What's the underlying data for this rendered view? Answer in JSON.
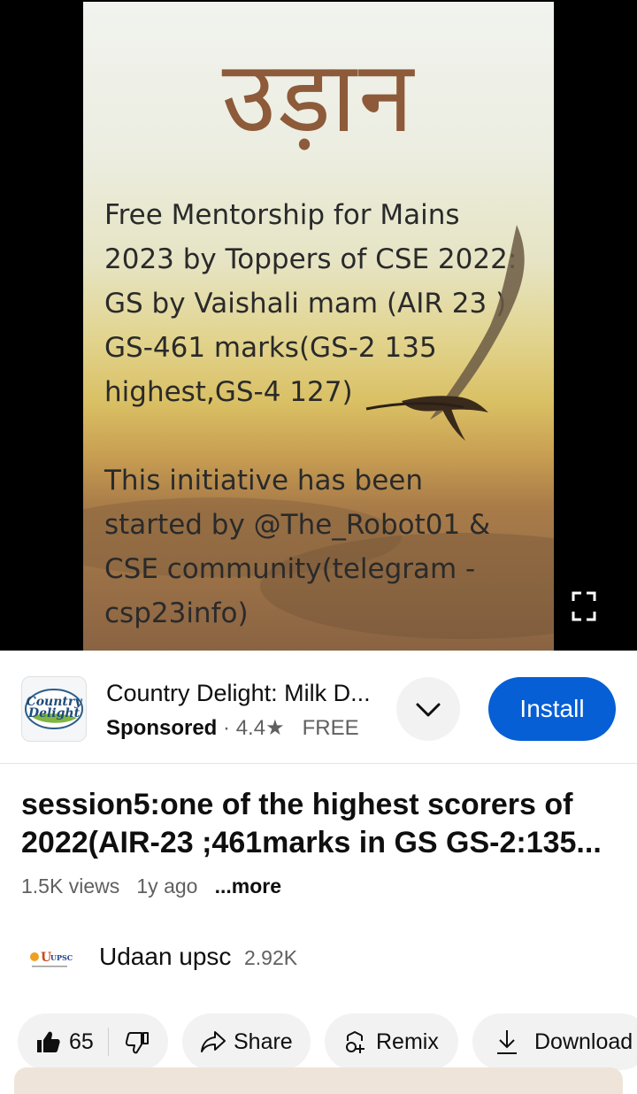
{
  "video": {
    "poster_title": "उड़ान",
    "poster_lines": [
      "Free Mentorship for Mains",
      "2023 by Toppers of CSE 2022:",
      "GS by Vaishali mam (AIR 23 )",
      "GS-461 marks(GS-2 135",
      "highest,GS-4 127)",
      "This initiative has been",
      "started by @The_Robot01 &",
      "CSE community(telegram -",
      "csp23info)"
    ],
    "progress_fraction": 0.03
  },
  "ad": {
    "logo_text_1": "Country",
    "logo_text_2": "Delight",
    "title": "Country Delight: Milk D...",
    "sponsored": "Sponsored",
    "separator": "·",
    "rating": "4.4",
    "price": "FREE",
    "install_label": "Install",
    "colors": {
      "install_bg": "#065fd4"
    }
  },
  "video_title": {
    "line1": "session5:one of the highest scorers of",
    "line2": "2022(AIR-23 ;461marks in GS GS-2:135..."
  },
  "meta": {
    "views": "1.5K views",
    "age": "1y ago",
    "more": "...more"
  },
  "channel": {
    "name": "Udaan upsc",
    "subscribers": "2.92K",
    "logo_text": "UPSC"
  },
  "actions": {
    "likes": "65",
    "share": "Share",
    "remix": "Remix",
    "download": "Download"
  }
}
